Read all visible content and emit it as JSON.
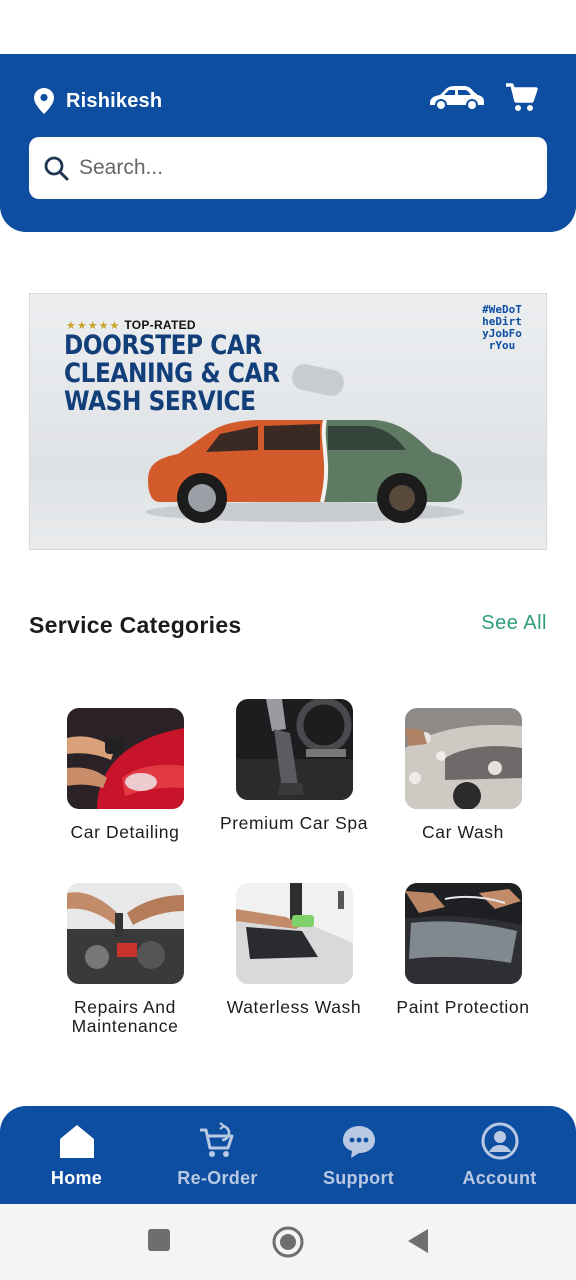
{
  "header": {
    "location": "Rishikesh",
    "search_placeholder": "Search..."
  },
  "banner": {
    "rating_label": "TOP-RATED",
    "headline": [
      "DOORSTEP CAR",
      "CLEANING & CAR",
      "WASH SERVICE"
    ],
    "hashtag": "#WeDoTheDirtyJobForYou"
  },
  "section": {
    "title": "Service Categories",
    "see_all": "See All"
  },
  "categories": [
    {
      "label": "Car Detailing",
      "icon": "car-detailing-image"
    },
    {
      "label": "Premium Car Spa",
      "icon": "car-spa-image"
    },
    {
      "label": "Car Wash",
      "icon": "car-wash-image"
    },
    {
      "label": "Repairs And Maintenance",
      "icon": "repairs-image"
    },
    {
      "label": "Waterless Wash",
      "icon": "waterless-wash-image"
    },
    {
      "label": "Paint Protection",
      "icon": "paint-protection-image"
    }
  ],
  "nav": [
    {
      "label": "Home",
      "icon": "home-icon",
      "active": true
    },
    {
      "label": "Re-Order",
      "icon": "reorder-cart-icon",
      "active": false
    },
    {
      "label": "Support",
      "icon": "support-chat-icon",
      "active": false
    },
    {
      "label": "Account",
      "icon": "account-icon",
      "active": false
    }
  ],
  "colors": {
    "primary": "#0d4ea1",
    "accent": "#2e9e7f"
  }
}
